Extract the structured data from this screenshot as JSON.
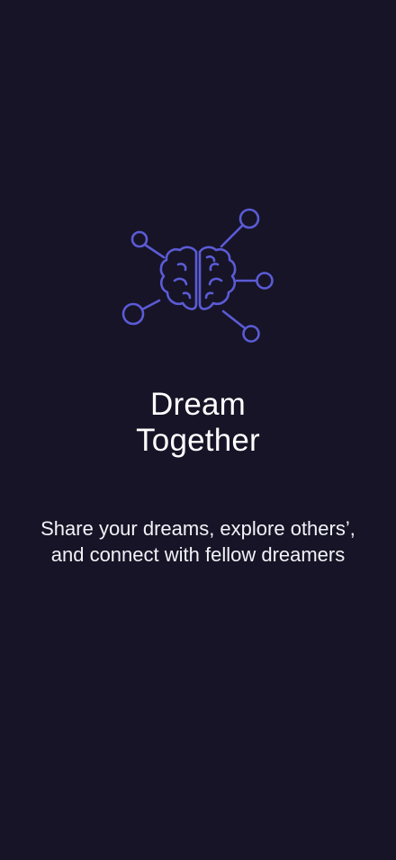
{
  "onboarding": {
    "illustration_icon": "brain-network-icon",
    "title_line1": "Dream",
    "title_line2": "Together",
    "subtitle": "Share your dreams, explore others’, and connect with fellow dreamers"
  },
  "colors": {
    "background": "#161426",
    "accent": "#5B5BD6",
    "text": "#FFFFFF"
  }
}
